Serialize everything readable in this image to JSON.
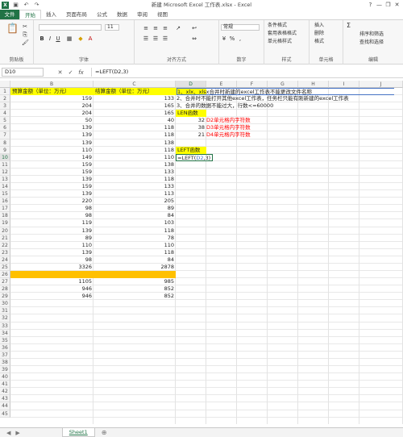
{
  "window": {
    "title": "新建 Microsoft Excel 工作表.xlsx - Excel",
    "help": "?",
    "minimize": "—",
    "restore": "❐",
    "close": "✕"
  },
  "tabs": [
    "文件",
    "开始",
    "插入",
    "页面布局",
    "公式",
    "数据",
    "审阅",
    "视图"
  ],
  "ribbon": {
    "groups": [
      "剪贴板",
      "字体",
      "对齐方式",
      "数字",
      "样式",
      "单元格",
      "编辑"
    ],
    "font_name": "",
    "font_size": "11",
    "number_format": "常规",
    "styles": [
      "条件格式",
      "套用表格格式",
      "单元格样式"
    ],
    "cells": [
      "插入",
      "删除",
      "格式"
    ],
    "editing": [
      "Σ",
      "排序和筛选",
      "查找和选择"
    ]
  },
  "formula_bar": {
    "name_box": "D10",
    "cancel": "✕",
    "enter": "✓",
    "fx": "fx",
    "formula": "=LEFT(D2,3)"
  },
  "columns": [
    "B",
    "C",
    "D",
    "E",
    "F",
    "G",
    "H",
    "I",
    "J"
  ],
  "rows": [
    "1",
    "2",
    "3",
    "4",
    "5",
    "6",
    "7",
    "8",
    "9",
    "10",
    "11",
    "12",
    "13",
    "14",
    "15",
    "16",
    "17",
    "18",
    "19",
    "20",
    "21",
    "22",
    "23",
    "24",
    "25",
    "26",
    "27",
    "28",
    "29",
    "30",
    "31",
    "32",
    "33",
    "34",
    "35",
    "36",
    "37",
    "38",
    "39",
    "40",
    "41",
    "42",
    "43",
    "44",
    "45"
  ],
  "headers": {
    "B": "预算金额（单位：万元）",
    "C": "结算金额（单位：万元）"
  },
  "colB": [
    "159",
    "204",
    "204",
    "50",
    "139",
    "139",
    "139",
    "110",
    "149",
    "159",
    "159",
    "139",
    "159",
    "139",
    "220",
    "98",
    "98",
    "119",
    "139",
    "89",
    "110",
    "139",
    "98",
    "3326",
    "",
    "1105",
    "946",
    "946"
  ],
  "colC": [
    "133",
    "165",
    "165",
    "40",
    "118",
    "118",
    "138",
    "118",
    "110",
    "138",
    "133",
    "118",
    "133",
    "113",
    "205",
    "89",
    "84",
    "103",
    "118",
    "78",
    "110",
    "118",
    "84",
    "2878",
    "",
    "985",
    "852",
    "852"
  ],
  "notes": {
    "r1": "1、xlx、xlsx合并时新建的excel工作表不能更改文件名称",
    "r2": "2、合并时不能打开其他excel工作表，任务栏只能有刚新建的excel工作表",
    "r3": "3、合并的数据不能过大，行数<=60000",
    "len_title": "LEN函数",
    "len1_val": "32",
    "len1_txt": "D2单元格内字符数",
    "len2_val": "38",
    "len2_txt": "D3单元格内字符数",
    "len3_val": "21",
    "len3_txt": "D4单元格内字符数",
    "left_title": "LEFT函数",
    "edit_prefix": "=LEFT(",
    "edit_ref": "D2",
    "edit_suffix": ",3)"
  },
  "sheet": {
    "name": "Sheet1",
    "add": "⊕"
  },
  "colors": {
    "accent": "#217346",
    "highlight": "#ffff00",
    "orange": "#ffc000",
    "red": "#ff0000",
    "blue": "#4472c4"
  }
}
